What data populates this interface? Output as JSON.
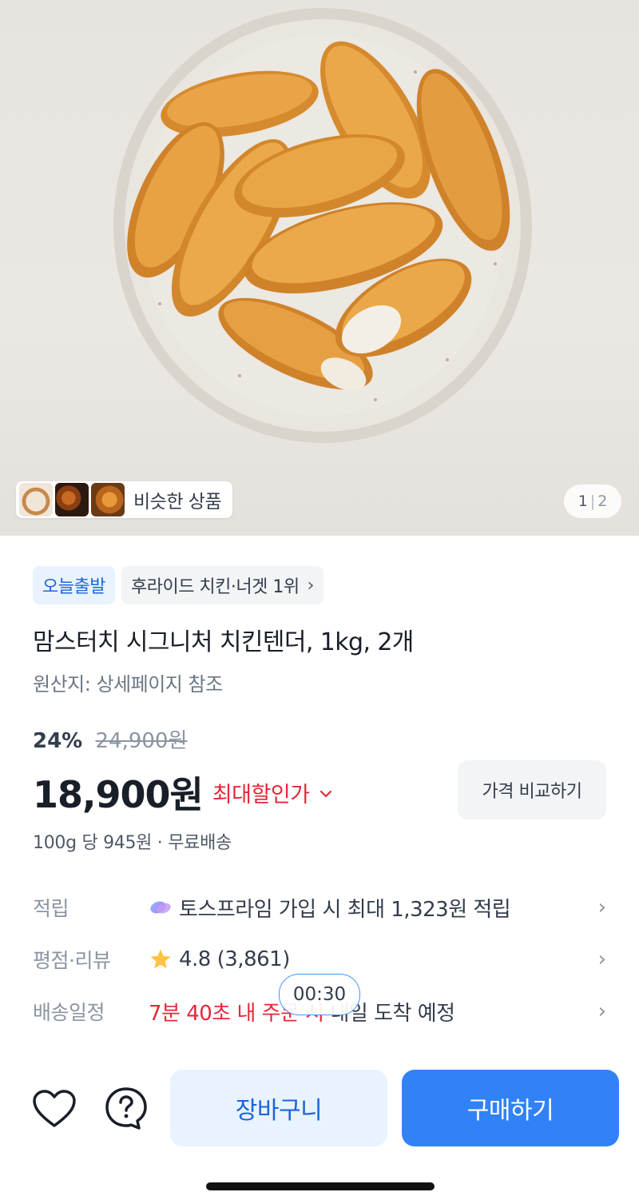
{
  "hero": {
    "image_desc": "chicken-tenders-plate",
    "similar_label": "비슷한 상품",
    "page_current": "1",
    "page_total": "2"
  },
  "badges": {
    "today_ship": "오늘출발",
    "ranking": "후라이드 치킨·너겟 1위"
  },
  "product": {
    "title": "맘스터치 시그니처 치킨텐더, 1kg, 2개",
    "origin": "원산지: 상세페이지 참조",
    "discount_rate": "24%",
    "original_price": "24,900원",
    "price": "18,900원",
    "max_discount_label": "최대할인가",
    "compare_label": "가격 비교하기",
    "unit_price": "100g 당 945원 · 무료배송"
  },
  "details": {
    "points_label": "적립",
    "points_value": "토스프라임 가입 시 최대 1,323원 적립",
    "rating_label": "평점·리뷰",
    "rating_value": "4.8 (3,861)",
    "delivery_label": "배송일정",
    "delivery_highlight": "7분 40초 내 주문 시",
    "delivery_value": " 내일 도착 예정"
  },
  "timer": "00:30",
  "bottom": {
    "cart_label": "장바구니",
    "buy_label": "구매하기"
  },
  "colors": {
    "primary": "#3182f6",
    "primary_light": "#e8f3ff",
    "sale_red": "#e42939",
    "text_main": "#191f28",
    "text_sub": "#8b95a1"
  }
}
